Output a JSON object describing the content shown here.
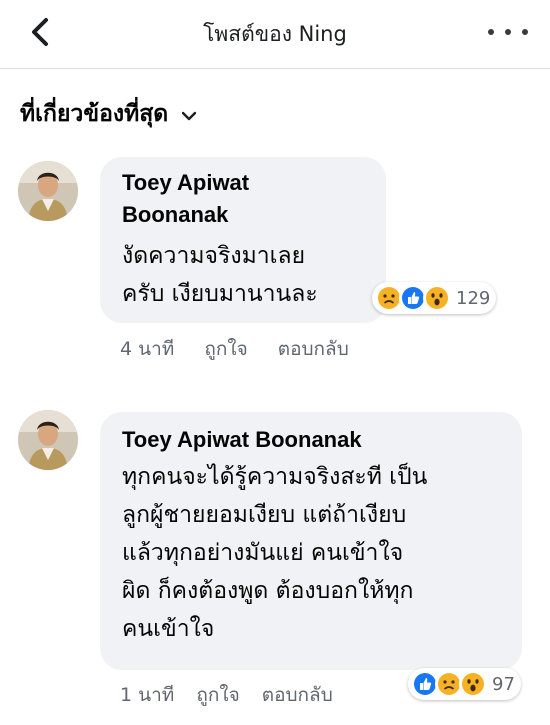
{
  "header": {
    "title": "โพสต์ของ Ning"
  },
  "filter": {
    "label": "ที่เกี่ยวข้องที่สุด"
  },
  "comments": [
    {
      "author_line1": "Toey Apiwat",
      "author_line2": "Boonanak",
      "text_lines": [
        "งัดความจริงมาเลย",
        "ครับ เงียบมานานละ"
      ],
      "reactions": [
        "sad",
        "like",
        "wow"
      ],
      "reaction_count": "129",
      "time": "4 นาที",
      "like_label": "ถูกใจ",
      "reply_label": "ตอบกลับ"
    },
    {
      "author": "Toey Apiwat Boonanak",
      "text_lines": [
        "ทุกคนจะได้รู้ความจริงสะที เป็น",
        "ลูกผู้ชายยอมเงียบ แต่ถ้าเงียบ",
        "แล้วทุกอย่างมันแย่ คนเข้าใจ",
        "ผิด ก็คงต้องพูด ต้องบอกให้ทุก",
        "คนเข้าใจ"
      ],
      "reactions": [
        "like",
        "sad",
        "wow"
      ],
      "reaction_count": "97",
      "time": "1 นาที",
      "like_label": "ถูกใจ",
      "reply_label": "ตอบกลับ"
    }
  ],
  "colors": {
    "like": "#1877f2",
    "sad": "#f7b125",
    "wow": "#f7b125",
    "bubble": "#f0f2f5",
    "meta": "#606770"
  }
}
